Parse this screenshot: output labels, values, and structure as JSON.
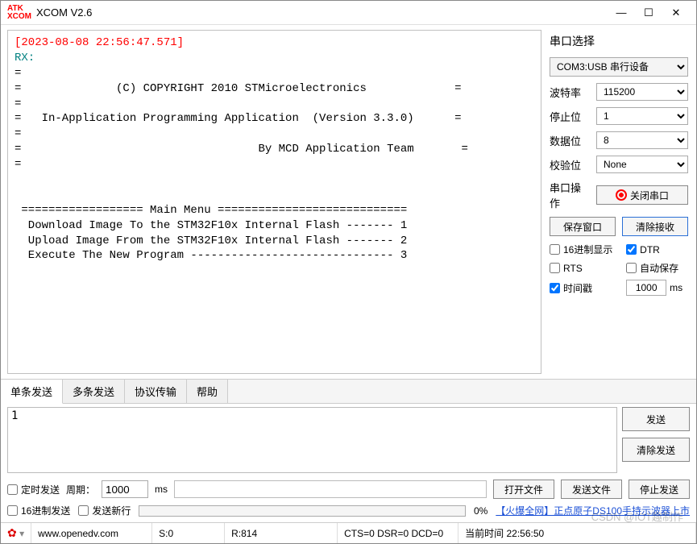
{
  "window": {
    "title": "XCOM V2.6",
    "logo": "ATK\nXCOM"
  },
  "rx": {
    "timestamp": "[2023-08-08 22:56:47.571]",
    "rx_label": "RX:",
    "body": "=\n=              (C) COPYRIGHT 2010 STMicroelectronics             =\n=\n=   In-Application Programming Application  (Version 3.3.0)      =\n=\n=                                   By MCD Application Team       =\n=\n\n\n ================== Main Menu ============================\n  Download Image To the STM32F10x Internal Flash ------- 1\n  Upload Image From the STM32F10x Internal Flash ------- 2\n  Execute The New Program ------------------------------ 3"
  },
  "serial": {
    "section": "串口选择",
    "port": "COM3:USB 串行设备",
    "baud_label": "波特率",
    "baud": "115200",
    "stop_label": "停止位",
    "stop": "1",
    "data_label": "数据位",
    "data": "8",
    "parity_label": "校验位",
    "parity": "None",
    "op_label": "串口操作",
    "op_btn": "关闭串口",
    "save_win_btn": "保存窗口",
    "clear_rx_btn": "清除接收",
    "hex_disp": "16进制显示",
    "dtr": "DTR",
    "rts": "RTS",
    "autosave": "自动保存",
    "timestamp": "时间戳",
    "ts_interval": "1000",
    "ts_unit": "ms"
  },
  "tabs": {
    "t0": "单条发送",
    "t1": "多条发送",
    "t2": "协议传输",
    "t3": "帮助"
  },
  "send": {
    "text": "1",
    "send_btn": "发送",
    "clear_btn": "清除发送"
  },
  "lower": {
    "timed_send": "定时发送",
    "period_label": "周期：",
    "period": "1000",
    "period_unit": "ms",
    "open_file_btn": "打开文件",
    "send_file_btn": "发送文件",
    "stop_send_btn": "停止发送",
    "hex_send": "16进制发送",
    "send_newline": "发送新行",
    "progress_pct": "0%",
    "promo": "【火爆全网】正点原子DS100手持示波器上市"
  },
  "status": {
    "url": "www.openedv.com",
    "s": "S:0",
    "r": "R:814",
    "lines": "CTS=0 DSR=0 DCD=0",
    "time_label": "当前时间",
    "time": "22:56:50"
  },
  "watermark": "CSDN @IOT趣制作"
}
